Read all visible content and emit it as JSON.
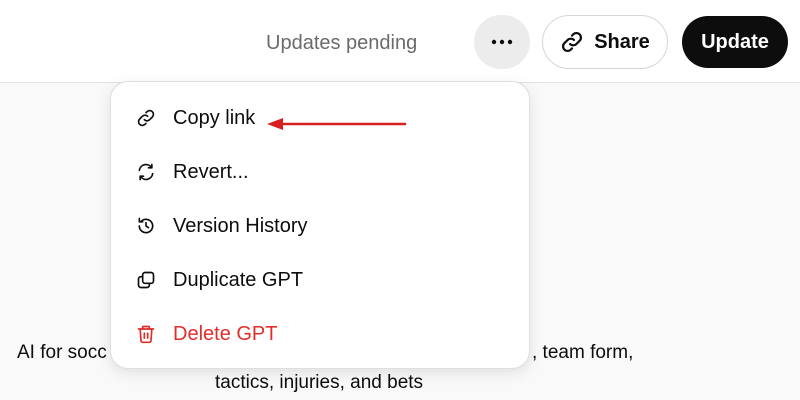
{
  "header": {
    "status": "Updates pending",
    "share_label": "Share",
    "update_label": "Update"
  },
  "menu": {
    "items": [
      {
        "label": "Copy link",
        "icon": "link-icon"
      },
      {
        "label": "Revert...",
        "icon": "revert-icon"
      },
      {
        "label": "Version History",
        "icon": "history-icon"
      },
      {
        "label": "Duplicate GPT",
        "icon": "duplicate-icon"
      },
      {
        "label": "Delete GPT",
        "icon": "trash-icon",
        "color": "#e02e2a"
      }
    ]
  },
  "description": {
    "line1_start": "AI for socc",
    "line1_end": ", team form,",
    "line2": "tactics, injuries, and bets"
  },
  "annotation": {
    "arrow_color": "#d81e1e"
  }
}
